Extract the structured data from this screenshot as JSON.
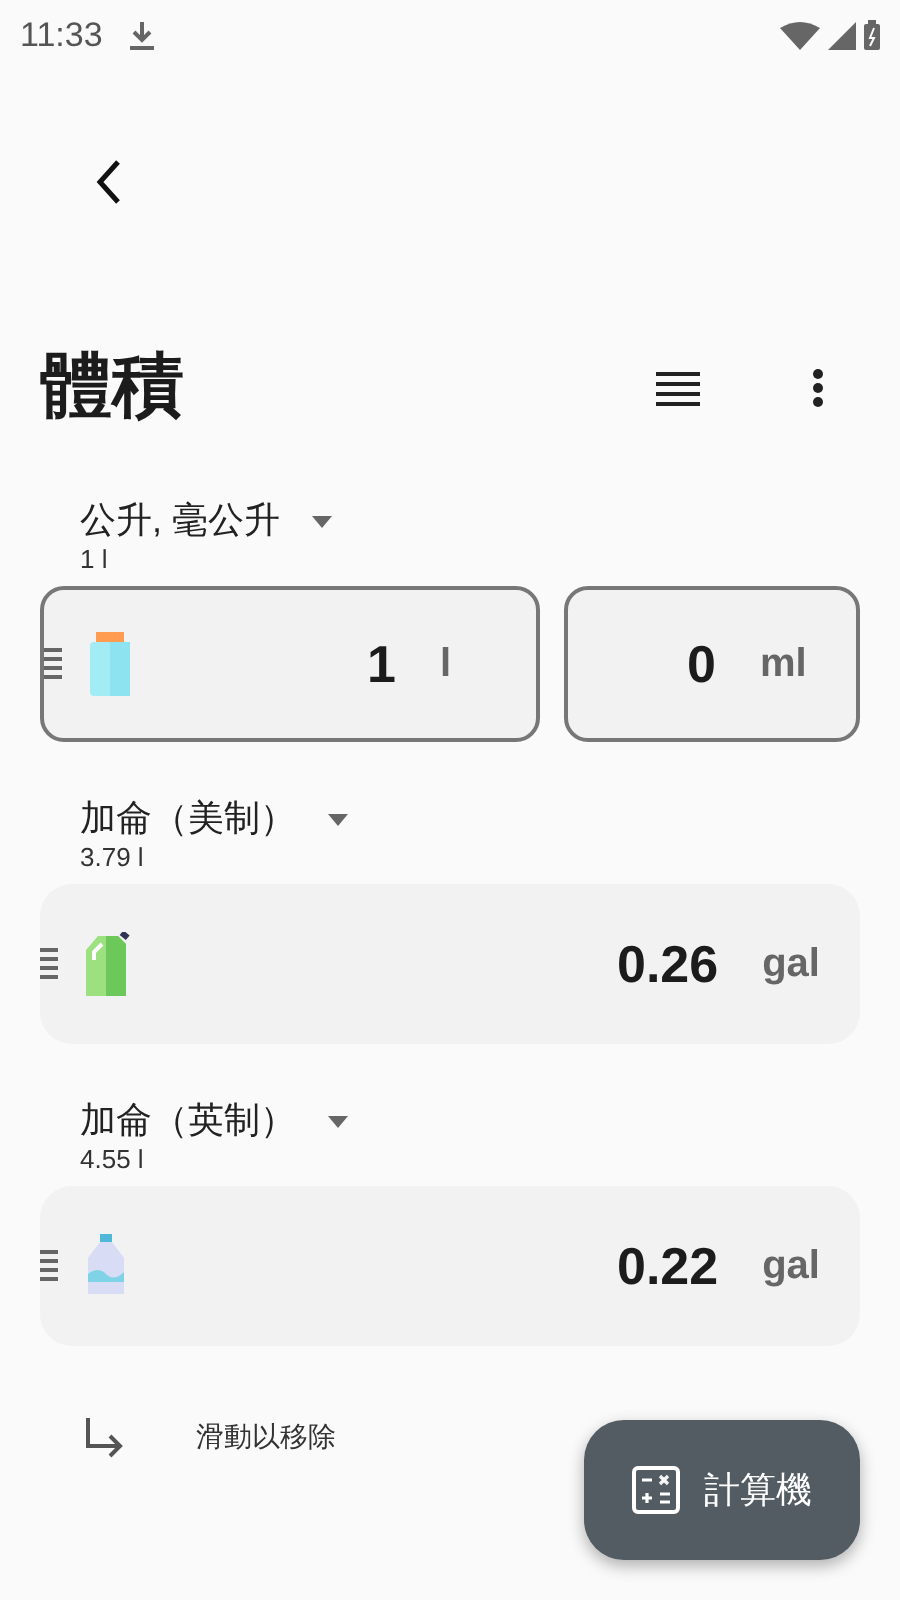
{
  "status_bar": {
    "time": "11:33"
  },
  "title": "體積",
  "units": [
    {
      "kind": "split",
      "name": "公升, 毫公升",
      "ratio": "1 l",
      "fields": [
        {
          "value": "1",
          "unit": "l"
        },
        {
          "value": "0",
          "unit": "ml"
        }
      ]
    },
    {
      "kind": "single",
      "name": "加侖（美制）",
      "ratio": "3.79 l",
      "fields": [
        {
          "value": "0.26",
          "unit": "gal"
        }
      ]
    },
    {
      "kind": "single",
      "name": "加侖（英制）",
      "ratio": "4.55 l",
      "fields": [
        {
          "value": "0.22",
          "unit": "gal"
        }
      ]
    }
  ],
  "hint": "滑動以移除",
  "fab": {
    "label": "計算機"
  }
}
